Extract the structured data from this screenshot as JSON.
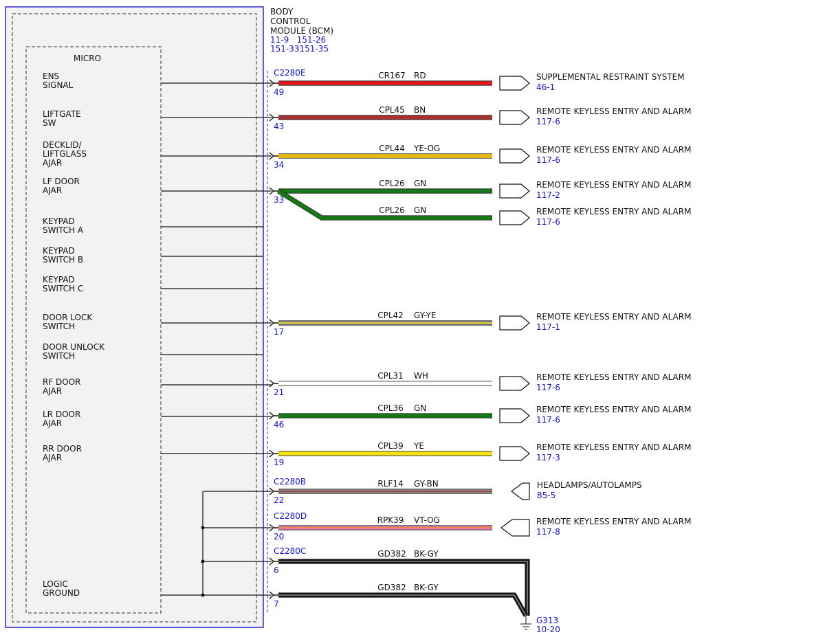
{
  "module": {
    "name_lines": [
      "BODY",
      "CONTROL",
      "MODULE (BCM)"
    ],
    "refs_lines": [
      "11-9   151-26",
      "151-33151-35"
    ],
    "micro_label": "MICRO"
  },
  "inputs": [
    {
      "lines": [
        "ENS",
        "SIGNAL"
      ]
    },
    {
      "lines": [
        "LIFTGATE",
        "SW"
      ]
    },
    {
      "lines": [
        "DECKLID/",
        "LIFTGLASS",
        "AJAR"
      ]
    },
    {
      "lines": [
        "LF DOOR",
        "AJAR"
      ]
    },
    {
      "lines": [
        "KEYPAD",
        "SWITCH A"
      ]
    },
    {
      "lines": [
        "KEYPAD",
        "SWITCH B"
      ]
    },
    {
      "lines": [
        "KEYPAD",
        "SWITCH C"
      ]
    },
    {
      "lines": [
        "DOOR LOCK",
        "SWITCH"
      ]
    },
    {
      "lines": [
        "DOOR UNLOCK",
        "SWITCH"
      ]
    },
    {
      "lines": [
        "RF DOOR",
        "AJAR"
      ]
    },
    {
      "lines": [
        "LR DOOR",
        "AJAR"
      ]
    },
    {
      "lines": [
        "RR DOOR",
        "AJAR"
      ]
    },
    {
      "lines": [
        "LOGIC",
        "GROUND"
      ]
    }
  ],
  "connectors": [
    "C2280E",
    "C2280B",
    "C2280D",
    "C2280C"
  ],
  "wires": [
    {
      "pin": "49",
      "circuit": "CR167",
      "color_code": "RD",
      "colors": [
        "#e31a1c"
      ],
      "dest": "SUPPLEMENTAL RESTRAINT SYSTEM",
      "ref": "46-1"
    },
    {
      "pin": "43",
      "circuit": "CPL45",
      "color_code": "BN",
      "colors": [
        "#a8302e"
      ],
      "dest": "REMOTE KEYLESS ENTRY AND ALARM",
      "ref": "117-6"
    },
    {
      "pin": "34",
      "circuit": "CPL44",
      "color_code": "YE-OG",
      "colors": [
        "#f4e20c",
        "#f08c1a"
      ],
      "dest": "REMOTE KEYLESS ENTRY AND ALARM",
      "ref": "117-6"
    },
    {
      "pin": "33",
      "circuit": "CPL26",
      "color_code": "GN",
      "colors": [
        "#167a16"
      ],
      "dest": "REMOTE KEYLESS ENTRY AND ALARM",
      "ref": "117-2"
    },
    {
      "pin": "",
      "circuit": "CPL26",
      "color_code": "GN",
      "colors": [
        "#167a16"
      ],
      "dest": "REMOTE KEYLESS ENTRY AND ALARM",
      "ref": "117-6"
    },
    {
      "pin": "17",
      "circuit": "CPL42",
      "color_code": "GY-YE",
      "colors": [
        "#8c8c8c",
        "#f4e20c"
      ],
      "dest": "REMOTE KEYLESS ENTRY AND ALARM",
      "ref": "117-1"
    },
    {
      "pin": "21",
      "circuit": "CPL31",
      "color_code": "WH",
      "colors": [
        "#ffffff"
      ],
      "dest": "REMOTE KEYLESS ENTRY AND ALARM",
      "ref": "117-6"
    },
    {
      "pin": "46",
      "circuit": "CPL36",
      "color_code": "GN",
      "colors": [
        "#167a16"
      ],
      "dest": "REMOTE KEYLESS ENTRY AND ALARM",
      "ref": "117-6"
    },
    {
      "pin": "19",
      "circuit": "CPL39",
      "color_code": "YE",
      "colors": [
        "#f4e20c"
      ],
      "dest": "REMOTE KEYLESS ENTRY AND ALARM",
      "ref": "117-3"
    },
    {
      "pin": "22",
      "circuit": "RLF14",
      "color_code": "GY-BN",
      "colors": [
        "#8c8c8c",
        "#a8302e"
      ],
      "dest": "HEADLAMPS/AUTOLAMPS",
      "ref": "85-5"
    },
    {
      "pin": "20",
      "circuit": "RPK39",
      "color_code": "VT-OG",
      "colors": [
        "#e678b4",
        "#f08c1a"
      ],
      "dest": "REMOTE KEYLESS ENTRY AND ALARM",
      "ref": "117-8"
    },
    {
      "pin": "6",
      "circuit": "GD382",
      "color_code": "BK-GY",
      "colors": [
        "#111111",
        "#8c8c8c"
      ],
      "dest": "",
      "ref": ""
    },
    {
      "pin": "7",
      "circuit": "GD382",
      "color_code": "BK-GY",
      "colors": [
        "#111111",
        "#8c8c8c"
      ],
      "dest": "",
      "ref": ""
    }
  ],
  "ground": {
    "name": "G313",
    "ref": "10-20"
  },
  "colors": {
    "module_border": "#2a2ad0",
    "ref_text": "#1414d2",
    "fill": "#f2f2f2"
  }
}
